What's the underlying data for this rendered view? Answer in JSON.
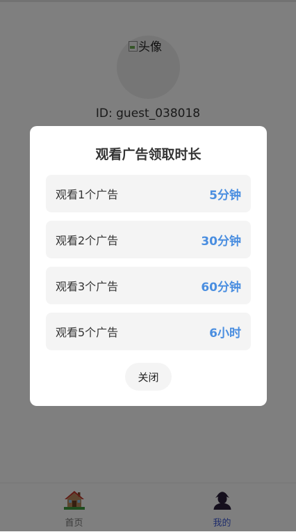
{
  "profile": {
    "avatar_alt": "头像",
    "user_id": "ID: guest_038018"
  },
  "modal": {
    "title": "观看广告领取时长",
    "options": [
      {
        "label": "观看1个广告",
        "reward": "5分钟"
      },
      {
        "label": "观看2个广告",
        "reward": "30分钟"
      },
      {
        "label": "观看3个广告",
        "reward": "60分钟"
      },
      {
        "label": "观看5个广告",
        "reward": "6小时"
      }
    ],
    "close_label": "关闭"
  },
  "tabbar": {
    "items": [
      {
        "label": "首页",
        "icon": "home-icon",
        "active": false
      },
      {
        "label": "我的",
        "icon": "user-icon",
        "active": true
      }
    ]
  },
  "colors": {
    "accent": "#4a8ee0",
    "active_tab": "#3f5bd6",
    "inactive_tab": "#777777",
    "overlay": "rgba(0,0,0,0.5)"
  }
}
